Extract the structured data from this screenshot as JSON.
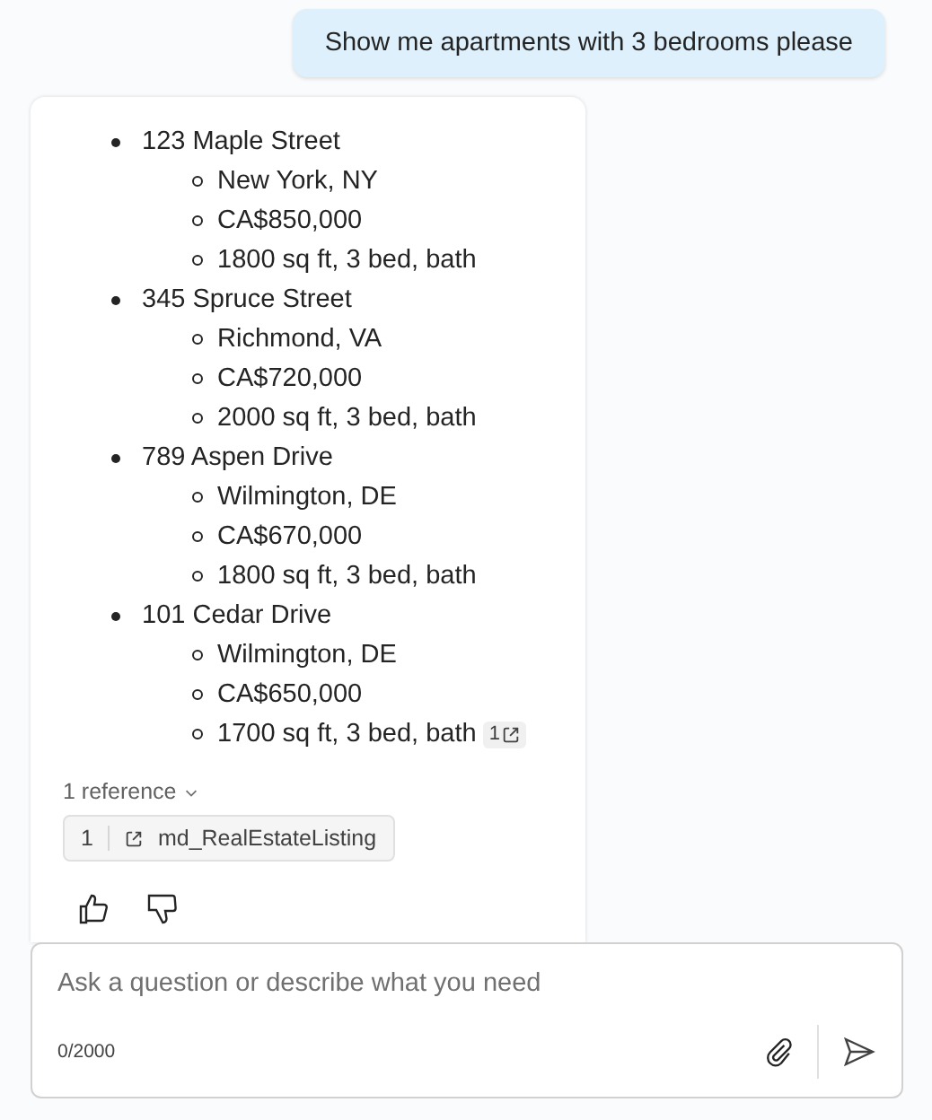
{
  "user_message": {
    "text": "Show me apartments with 3 bedrooms please"
  },
  "response": {
    "listings": [
      {
        "address": "123 Maple Street",
        "details": [
          {
            "text": "New York, NY"
          },
          {
            "text": "CA$850,000"
          },
          {
            "text": "1800 sq ft, 3 bed, bath"
          }
        ]
      },
      {
        "address": "345 Spruce Street",
        "details": [
          {
            "text": "Richmond, VA"
          },
          {
            "text": "CA$720,000"
          },
          {
            "text": "2000 sq ft, 3 bed, bath"
          }
        ]
      },
      {
        "address": "789 Aspen Drive",
        "details": [
          {
            "text": "Wilmington, DE"
          },
          {
            "text": "CA$670,000"
          },
          {
            "text": "1800 sq ft, 3 bed, bath"
          }
        ]
      },
      {
        "address": "101 Cedar Drive",
        "details": [
          {
            "text": "Wilmington, DE"
          },
          {
            "text": "CA$650,000"
          },
          {
            "text": "1700 sq ft, 3 bed, bath",
            "citation": "1"
          }
        ]
      }
    ],
    "references_toggle": {
      "label": "1 reference",
      "expanded": false
    },
    "references": [
      {
        "number": "1",
        "title": "md_RealEstateListing"
      }
    ]
  },
  "composer": {
    "placeholder": "Ask a question or describe what you need",
    "counter": "0/2000"
  }
}
